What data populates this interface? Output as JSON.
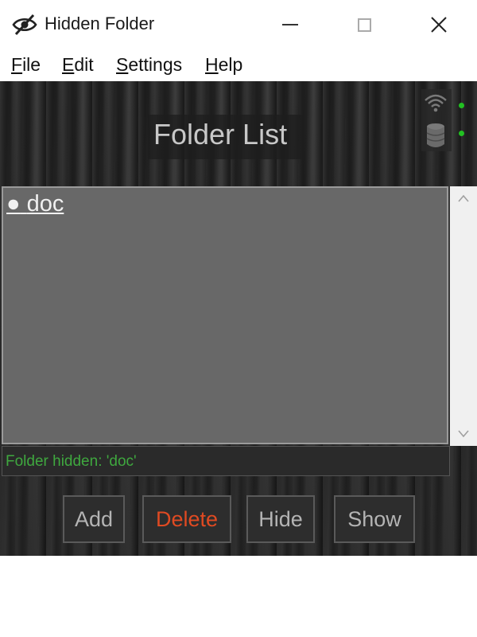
{
  "window": {
    "title": "Hidden Folder",
    "title_icon": "eye-slash-icon"
  },
  "menu": {
    "items": [
      {
        "label_first": "F",
        "label_rest": "ile"
      },
      {
        "label_first": "E",
        "label_rest": "dit"
      },
      {
        "label_first": "S",
        "label_rest": "ettings"
      },
      {
        "label_first": "H",
        "label_rest": "elp"
      }
    ]
  },
  "header": {
    "title": "Folder List",
    "status_icons": [
      "wifi-icon",
      "database-icon"
    ],
    "led_color": "#22c022"
  },
  "folders": [
    {
      "bullet": "●",
      "name": "doc"
    }
  ],
  "status": {
    "message": "Folder hidden: 'doc'",
    "color": "#3fa83f"
  },
  "buttons": {
    "add": "Add",
    "delete": "Delete",
    "hide": "Hide",
    "show": "Show",
    "delete_color": "#e04a22"
  }
}
